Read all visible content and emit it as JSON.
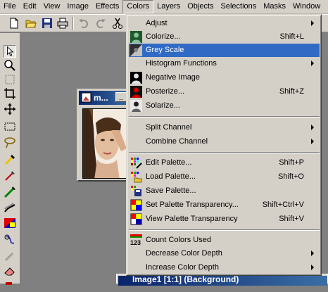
{
  "menubar": [
    "File",
    "Edit",
    "View",
    "Image",
    "Effects",
    "Colors",
    "Layers",
    "Objects",
    "Selections",
    "Masks",
    "Window"
  ],
  "image_window": {
    "title": "m..."
  },
  "bottom_window": {
    "title": "Image1 [1:1] (Background)"
  },
  "colors_menu": {
    "groups": [
      [
        {
          "label": "Adjust",
          "shortcut": "",
          "submenu": true,
          "icon": ""
        },
        {
          "label": "Colorize...",
          "shortcut": "Shift+L",
          "submenu": false,
          "icon": "colorize-icon"
        },
        {
          "label": "Grey Scale",
          "shortcut": "",
          "submenu": false,
          "icon": "grey-scale-icon",
          "highlighted": true
        },
        {
          "label": "Histogram Functions",
          "shortcut": "",
          "submenu": true,
          "icon": ""
        },
        {
          "label": "Negative Image",
          "shortcut": "",
          "submenu": false,
          "icon": "negative-image-icon"
        },
        {
          "label": "Posterize...",
          "shortcut": "Shift+Z",
          "submenu": false,
          "icon": "posterize-icon"
        },
        {
          "label": "Solarize...",
          "shortcut": "",
          "submenu": false,
          "icon": "solarize-icon"
        }
      ],
      [
        {
          "label": "Split Channel",
          "shortcut": "",
          "submenu": true,
          "icon": ""
        },
        {
          "label": "Combine Channel",
          "shortcut": "",
          "submenu": true,
          "icon": ""
        }
      ],
      [
        {
          "label": "Edit Palette...",
          "shortcut": "Shift+P",
          "submenu": false,
          "icon": "edit-palette-icon"
        },
        {
          "label": "Load Palette...",
          "shortcut": "Shift+O",
          "submenu": false,
          "icon": "load-palette-icon"
        },
        {
          "label": "Save Palette...",
          "shortcut": "",
          "submenu": false,
          "icon": "save-palette-icon"
        },
        {
          "label": "Set Palette Transparency...",
          "shortcut": "Shift+Ctrl+V",
          "submenu": false,
          "icon": "palette-transparency-icon"
        },
        {
          "label": "View Palette Transparency",
          "shortcut": "Shift+V",
          "submenu": false,
          "icon": "view-transparency-icon"
        }
      ],
      [
        {
          "label": "Count Colors Used",
          "shortcut": "",
          "submenu": false,
          "icon": "count-colors-icon"
        },
        {
          "label": "Decrease Color Depth",
          "shortcut": "",
          "submenu": true,
          "icon": ""
        },
        {
          "label": "Increase Color Depth",
          "shortcut": "",
          "submenu": true,
          "icon": ""
        }
      ]
    ]
  },
  "colors": {
    "highlight": "#316ac5",
    "face": "#d4d0c8",
    "workspace": "#808080",
    "titlebar": "#0a246a"
  }
}
